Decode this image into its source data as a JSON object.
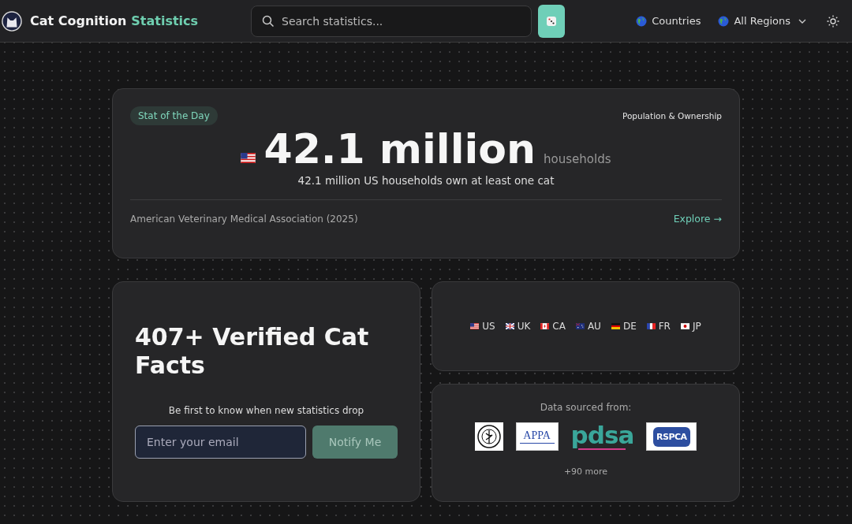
{
  "header": {
    "brand": "Cat Cognition",
    "brand_accent": "Statistics",
    "search": {
      "placeholder": "Search statistics..."
    },
    "nav": [
      {
        "label": "Countries",
        "dropdown": false
      },
      {
        "label": "All Regions",
        "dropdown": true
      }
    ]
  },
  "stat": {
    "badge": "Stat of the Day",
    "category": "Population & Ownership",
    "flag": {
      "kind": "us"
    },
    "value": "42.1 million",
    "unit": "households",
    "description": "42.1 million US households own at least one cat",
    "source": "American Veterinary Medical Association (2025)",
    "link": "Explore →"
  },
  "signup": {
    "title": "407+ Verified Cat Facts",
    "prompt": "Be first to know when new statistics drop",
    "email": {
      "placeholder": "Enter your email"
    },
    "button": "Notify Me"
  },
  "countries": [
    {
      "kind": "us",
      "label": "US"
    },
    {
      "kind": "uk",
      "label": "UK"
    },
    {
      "kind": "ca",
      "label": "CA"
    },
    {
      "kind": "au",
      "label": "AU"
    },
    {
      "kind": "de",
      "label": "DE"
    },
    {
      "kind": "fr",
      "label": "FR"
    },
    {
      "kind": "jp",
      "label": "JP"
    }
  ],
  "sources": {
    "heading": "Data sourced from:",
    "logos": [
      {
        "kind": "seal"
      },
      {
        "kind": "appa",
        "name": "APPA"
      },
      {
        "kind": "pdsa",
        "name": "pdsa"
      },
      {
        "kind": "rspca",
        "name": "RSPCA"
      }
    ],
    "more": "+90 more"
  }
}
